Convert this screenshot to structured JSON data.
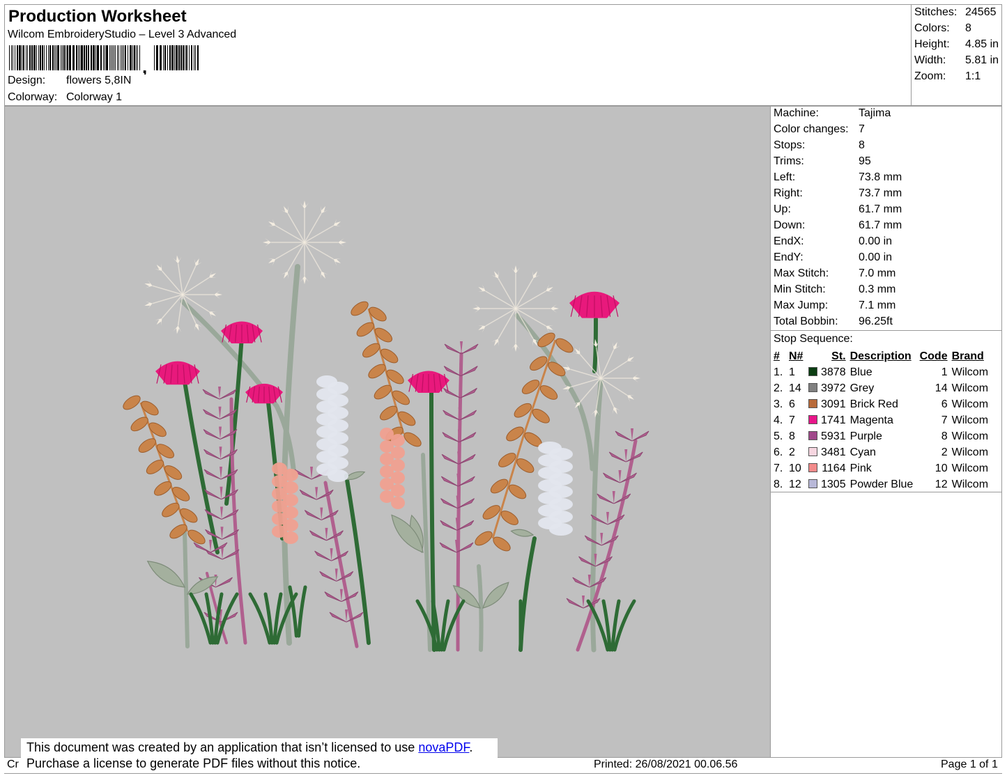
{
  "header": {
    "title": "Production Worksheet",
    "subtitle": "Wilcom EmbroideryStudio – Level 3 Advanced",
    "design_label": "Design:",
    "design_value": "flowers 5,8IN",
    "colorway_label": "Colorway:",
    "colorway_value": "Colorway 1"
  },
  "stats": [
    {
      "label": "Stitches:",
      "value": "24565"
    },
    {
      "label": "Colors:",
      "value": "8"
    },
    {
      "label": "Height:",
      "value": "4.85 in"
    },
    {
      "label": "Width:",
      "value": "5.81 in"
    },
    {
      "label": "Zoom:",
      "value": "1:1"
    }
  ],
  "machine": [
    {
      "label": "Machine:",
      "value": "Tajima"
    },
    {
      "label": "Color changes:",
      "value": "7"
    },
    {
      "label": "Stops:",
      "value": "8"
    },
    {
      "label": "Trims:",
      "value": "95"
    },
    {
      "label": "Left:",
      "value": "73.8 mm"
    },
    {
      "label": "Right:",
      "value": "73.7 mm"
    },
    {
      "label": "Up:",
      "value": "61.7 mm"
    },
    {
      "label": "Down:",
      "value": "61.7 mm"
    },
    {
      "label": "EndX:",
      "value": "0.00 in"
    },
    {
      "label": "EndY:",
      "value": "0.00 in"
    },
    {
      "label": "Max Stitch:",
      "value": "7.0 mm"
    },
    {
      "label": "Min Stitch:",
      "value": "0.3 mm"
    },
    {
      "label": "Max Jump:",
      "value": "7.1 mm"
    },
    {
      "label": "Total Bobbin:",
      "value": "96.25ft"
    }
  ],
  "stop_sequence": {
    "title": "Stop Sequence:",
    "headers": {
      "num": "#",
      "n": "N#",
      "st": "St.",
      "description": "Description",
      "code": "Code",
      "brand": "Brand"
    },
    "rows": [
      {
        "num": "1.",
        "n": "1",
        "color": "#0b3d12",
        "st": "3878",
        "description": "Blue",
        "code": "1",
        "brand": "Wilcom"
      },
      {
        "num": "2.",
        "n": "14",
        "color": "#808080",
        "st": "3972",
        "description": "Grey",
        "code": "14",
        "brand": "Wilcom"
      },
      {
        "num": "3.",
        "n": "6",
        "color": "#b86a3a",
        "st": "3091",
        "description": "Brick Red",
        "code": "6",
        "brand": "Wilcom"
      },
      {
        "num": "4.",
        "n": "7",
        "color": "#e8168a",
        "st": "1741",
        "description": "Magenta",
        "code": "7",
        "brand": "Wilcom"
      },
      {
        "num": "5.",
        "n": "8",
        "color": "#a0488a",
        "st": "5931",
        "description": "Purple",
        "code": "8",
        "brand": "Wilcom"
      },
      {
        "num": "6.",
        "n": "2",
        "color": "#f6d6e0",
        "st": "3481",
        "description": "Cyan",
        "code": "2",
        "brand": "Wilcom"
      },
      {
        "num": "7.",
        "n": "10",
        "color": "#f28a8a",
        "st": "1164",
        "description": "Pink",
        "code": "10",
        "brand": "Wilcom"
      },
      {
        "num": "8.",
        "n": "12",
        "color": "#b8b8d8",
        "st": "1305",
        "description": "Powder Blue",
        "code": "12",
        "brand": "Wilcom"
      }
    ]
  },
  "footer": {
    "notice_line1": "This document was created by an application that isn’t licensed to use ",
    "notice_link": "novaPDF",
    "notice_period": ".",
    "notice_line2": "Purchase a license to generate PDF files without this notice.",
    "left_fragment": "Cr",
    "printed": "Printed: 26/08/2021 00.06.56",
    "page": "Page 1 of 1"
  },
  "colors": {
    "canvas_bg": "#c0c0c0",
    "stem_green": "#2e6b35",
    "stem_grey": "#9aa89a",
    "leaf_grey": "#a4b09e",
    "brick": "#c9844a",
    "magenta": "#e8197c",
    "purple": "#b0608e",
    "cream": "#f3ece0",
    "pink": "#f0a090",
    "powder": "#e3e6ee"
  }
}
